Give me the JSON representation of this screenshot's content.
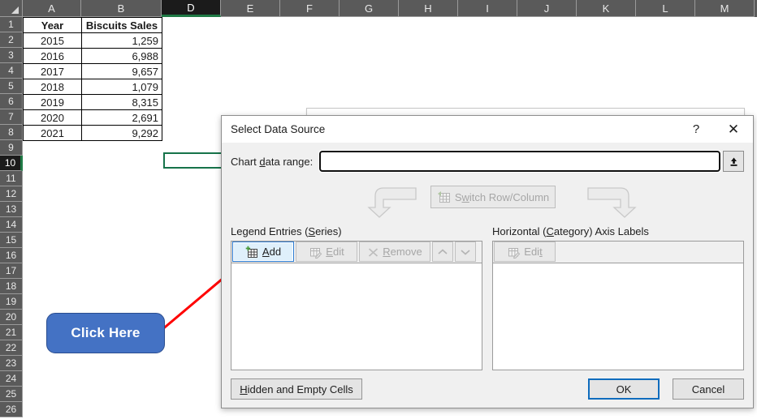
{
  "spreadsheet": {
    "columns": [
      "A",
      "B",
      "D",
      "E",
      "F",
      "G",
      "H",
      "I",
      "J",
      "K",
      "L",
      "M"
    ],
    "active_column": "D",
    "rows": [
      "1",
      "2",
      "3",
      "4",
      "5",
      "6",
      "7",
      "8",
      "9",
      "10",
      "11",
      "12",
      "13",
      "14",
      "15",
      "16",
      "17",
      "18",
      "19",
      "20",
      "21",
      "22",
      "23",
      "24",
      "25",
      "26"
    ],
    "active_row": "10",
    "table": {
      "headers": [
        "Year",
        "Biscuits Sales"
      ],
      "rows": [
        [
          "2015",
          "1,259"
        ],
        [
          "2016",
          "6,988"
        ],
        [
          "2017",
          "9,657"
        ],
        [
          "2018",
          "1,079"
        ],
        [
          "2019",
          "8,315"
        ],
        [
          "2020",
          "2,691"
        ],
        [
          "2021",
          "9,292"
        ]
      ]
    }
  },
  "callout": {
    "label": "Click Here",
    "fill_color": "#4472c4",
    "text_color": "#ffffff",
    "arrow_color": "#ff0000"
  },
  "dialog": {
    "title": "Select Data Source",
    "help_label": "?",
    "close_label": "✕",
    "chart_data_range": {
      "label_pre": "Chart ",
      "label_accel": "d",
      "label_post": "ata range:",
      "value": "",
      "placeholder": ""
    },
    "switch_button": {
      "label_pre": "S",
      "label_accel": "w",
      "label_post": "itch Row/Column",
      "enabled": false
    },
    "legend_pane": {
      "title_pre": "Legend Entries (",
      "title_accel": "S",
      "title_post": "eries)",
      "buttons": [
        {
          "pre": "",
          "accel": "A",
          "post": "dd",
          "enabled": true
        },
        {
          "pre": "",
          "accel": "E",
          "post": "dit",
          "enabled": false
        },
        {
          "pre": "",
          "accel": "R",
          "post": "emove",
          "enabled": false
        }
      ],
      "move_up_label": "⌃",
      "move_down_label": "⌄",
      "items": []
    },
    "axis_pane": {
      "title_pre": "Horizontal (",
      "title_accel": "C",
      "title_post": "ategory) Axis Labels",
      "edit_button": {
        "pre": "Edi",
        "accel": "t",
        "post": "",
        "enabled": false
      },
      "items": []
    },
    "footer": {
      "hidden_cells": {
        "pre": "",
        "accel": "H",
        "post": "idden and Empty Cells"
      },
      "ok_label": "OK",
      "cancel_label": "Cancel",
      "ok_focused": true
    }
  }
}
